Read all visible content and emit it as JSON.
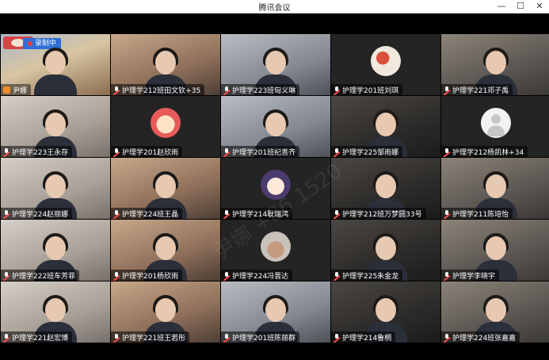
{
  "window": {
    "title": "腾讯会议"
  },
  "meeting": {
    "recording_label": "录制中",
    "watermark": "尹娜 +86 1520"
  },
  "participants": [
    {
      "name": "尹娜",
      "kind": "host"
    },
    {
      "name": "护理学212班田文钦+35",
      "kind": "cam"
    },
    {
      "name": "护理学223班匈义琳",
      "kind": "cam"
    },
    {
      "name": "护理学201班刘琪",
      "kind": "avatar-art"
    },
    {
      "name": "护理学221邓子禹",
      "kind": "cam"
    },
    {
      "name": "护理学223王永存",
      "kind": "cam"
    },
    {
      "name": "护理学201赵欣雨",
      "kind": "avatar-cartoon"
    },
    {
      "name": "护理学201班纪善齐",
      "kind": "cam"
    },
    {
      "name": "护理学225邹雨娜",
      "kind": "cam"
    },
    {
      "name": "护理学212杨凯林+34",
      "kind": "avatar-grey"
    },
    {
      "name": "护理学224赵丽娜",
      "kind": "cam"
    },
    {
      "name": "护理学224班王晶",
      "kind": "cam"
    },
    {
      "name": "护理学214耿瑞鸿",
      "kind": "avatar-anime"
    },
    {
      "name": "护理学212班万梦圆33号",
      "kind": "cam"
    },
    {
      "name": "护理学211陈培怡",
      "kind": "cam"
    },
    {
      "name": "护理学222班车芳菲",
      "kind": "cam"
    },
    {
      "name": "护理学201杨欣雨",
      "kind": "cam"
    },
    {
      "name": "护理学224冯晋达",
      "kind": "avatar-photo"
    },
    {
      "name": "护理学225朱金龙",
      "kind": "cam"
    },
    {
      "name": "护理学李晓宇",
      "kind": "cam"
    },
    {
      "name": "护理学221赵宏博",
      "kind": "cam"
    },
    {
      "name": "护理学221班王若彤",
      "kind": "cam"
    },
    {
      "name": "护理学201班陈丽群",
      "kind": "cam"
    },
    {
      "name": "护理学214鲁桐",
      "kind": "cam"
    },
    {
      "name": "护理学224班张嘉嘉",
      "kind": "cam"
    }
  ]
}
